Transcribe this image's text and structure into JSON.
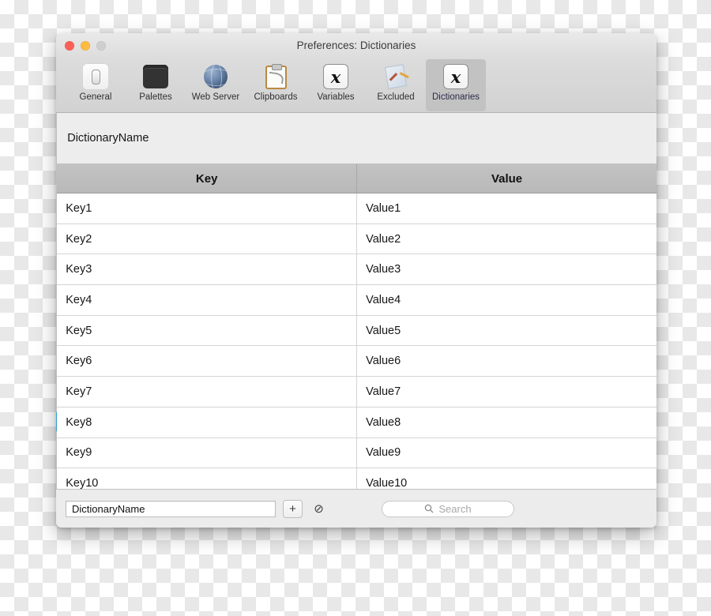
{
  "window": {
    "title": "Preferences: Dictionaries",
    "traffic_lights": [
      "close-button",
      "minimize-button",
      "zoom-button"
    ]
  },
  "toolbar": {
    "items": [
      {
        "label": "General",
        "icon": "toggle-switch-icon",
        "selected": false
      },
      {
        "label": "Palettes",
        "icon": "dark-panel-icon",
        "selected": false
      },
      {
        "label": "Web Server",
        "icon": "globe-icon",
        "selected": false
      },
      {
        "label": "Clipboards",
        "icon": "clipboard-icon",
        "selected": false
      },
      {
        "label": "Variables",
        "icon": "italic-x-icon",
        "selected": false
      },
      {
        "label": "Excluded",
        "icon": "paper-tools-icon",
        "selected": false
      },
      {
        "label": "Dictionaries",
        "icon": "italic-x-icon",
        "selected": true
      }
    ]
  },
  "sidebar": {
    "badge_glyph": "x",
    "selected_label": "DictionaryName",
    "selected_index": 18,
    "selected_color": "#2f9ed4",
    "rows": [
      {
        "redacted": true,
        "label": "",
        "blocks": [
          14,
          5,
          4,
          5,
          4,
          7,
          4,
          12,
          4,
          8
        ]
      },
      {
        "redacted": true,
        "label": "",
        "blocks": [
          9,
          3,
          6,
          3,
          4,
          3,
          8,
          6,
          5,
          4,
          14,
          4,
          9
        ]
      },
      {
        "redacted": true,
        "label": "",
        "blocks": [
          11,
          3,
          5,
          3,
          20,
          3,
          13,
          3,
          9
        ]
      },
      {
        "redacted": true,
        "label": "",
        "blocks": [
          13,
          4,
          14,
          4,
          6,
          4,
          8,
          4,
          6,
          4,
          9
        ]
      },
      {
        "redacted": true,
        "label": "",
        "blocks": [
          12,
          4,
          5,
          4,
          4
        ]
      },
      {
        "redacted": true,
        "label": "",
        "blocks": [
          17,
          3,
          14,
          3,
          11,
          3,
          8,
          3,
          5
        ]
      },
      {
        "redacted": true,
        "label": "",
        "blocks": [
          4,
          3,
          28,
          3,
          11
        ]
      },
      {
        "redacted": true,
        "label": "",
        "blocks": [
          10,
          4,
          7,
          4,
          9,
          4,
          10,
          4,
          12,
          4,
          10,
          4,
          6
        ]
      },
      {
        "redacted": true,
        "label": "",
        "blocks": [
          11,
          5,
          4,
          5,
          6,
          5,
          7,
          5,
          6,
          5,
          9,
          5,
          5
        ]
      },
      {
        "redacted": true,
        "label": "",
        "blocks": [
          16,
          4,
          7,
          4,
          17,
          4,
          7,
          4,
          5
        ]
      },
      {
        "redacted": true,
        "label": "",
        "blocks": [
          19
        ]
      },
      {
        "redacted": true,
        "label": "",
        "blocks": [
          7,
          3,
          6,
          3,
          4,
          3,
          7,
          3,
          5,
          3,
          6,
          3,
          8
        ]
      },
      {
        "redacted": true,
        "label": "",
        "blocks": [
          8
        ]
      },
      {
        "redacted": true,
        "label": "",
        "blocks": [
          28,
          5,
          22,
          4,
          13,
          4,
          5
        ]
      },
      {
        "redacted": true,
        "label": "",
        "blocks": [
          17,
          4,
          6,
          4,
          18,
          4,
          14,
          4,
          11
        ]
      },
      {
        "redacted": true,
        "label": "",
        "blocks": [
          8,
          3,
          15
        ]
      },
      {
        "redacted": false,
        "label": "DictionaryName",
        "blocks": []
      },
      {
        "redacted": true,
        "label": "",
        "blocks": [
          22,
          14,
          42,
          4,
          10,
          4,
          12,
          4,
          20,
          4,
          17,
          4,
          4
        ]
      },
      {
        "redacted": true,
        "label": "",
        "blocks": [
          21,
          14,
          14,
          4,
          13,
          4,
          8,
          4,
          16
        ]
      },
      {
        "redacted": true,
        "label": "",
        "blocks": [
          4,
          3,
          6,
          3,
          4,
          3,
          26,
          4,
          6,
          4,
          14,
          4,
          6,
          4,
          6,
          4,
          5,
          4,
          8,
          4,
          5,
          4,
          12
        ]
      }
    ]
  },
  "detail": {
    "dictionary_name": "DictionaryName",
    "table": {
      "columns": [
        "Key",
        "Value"
      ],
      "rows": [
        [
          "Key1",
          "Value1"
        ],
        [
          "Key2",
          "Value2"
        ],
        [
          "Key3",
          "Value3"
        ],
        [
          "Key4",
          "Value4"
        ],
        [
          "Key5",
          "Value5"
        ],
        [
          "Key6",
          "Value6"
        ],
        [
          "Key7",
          "Value7"
        ],
        [
          "Key8",
          "Value8"
        ],
        [
          "Key9",
          "Value9"
        ],
        [
          "Key10",
          "Value10"
        ]
      ]
    }
  },
  "bottom_bar": {
    "name_field_value": "DictionaryName",
    "add_button_label": "+",
    "disable_button_label": "⊘",
    "search_placeholder": "Search",
    "search_icon": "search-icon"
  }
}
